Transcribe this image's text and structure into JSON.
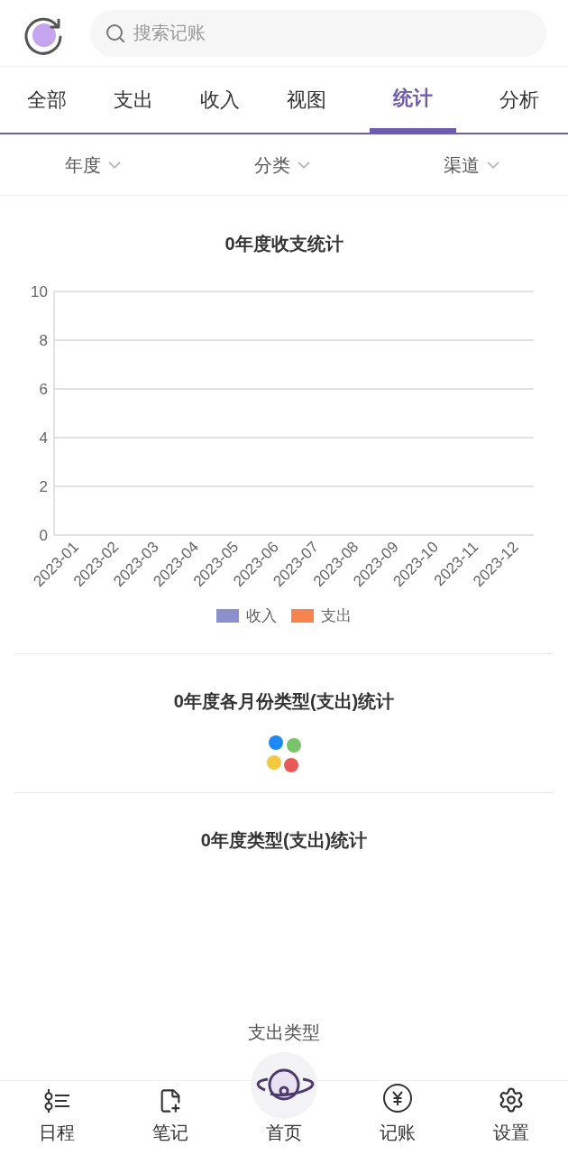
{
  "search": {
    "placeholder": "搜索记账"
  },
  "tabs": [
    {
      "label": "全部",
      "selected": false
    },
    {
      "label": "支出",
      "selected": false
    },
    {
      "label": "收入",
      "selected": false
    },
    {
      "label": "视图",
      "selected": false
    },
    {
      "label": "统计",
      "selected": true
    },
    {
      "label": "分析",
      "selected": false
    }
  ],
  "filters": [
    {
      "label": "年度"
    },
    {
      "label": "分类"
    },
    {
      "label": "渠道"
    }
  ],
  "sections": [
    {
      "title": "0年度收支统计",
      "kind": "chart",
      "chart_data": {
        "type": "bar",
        "categories": [
          "2023-01",
          "2023-02",
          "2023-03",
          "2023-04",
          "2023-05",
          "2023-06",
          "2023-07",
          "2023-08",
          "2023-09",
          "2023-10",
          "2023-11",
          "2023-12"
        ],
        "series": [
          {
            "name": "收入",
            "color": "#8c90cc",
            "values": [
              null,
              null,
              null,
              null,
              null,
              null,
              null,
              null,
              null,
              null,
              null,
              null
            ]
          },
          {
            "name": "支出",
            "color": "#f7844e",
            "values": [
              null,
              null,
              null,
              null,
              null,
              null,
              null,
              null,
              null,
              null,
              null,
              null
            ]
          }
        ],
        "grid": true,
        "ylim": [
          0,
          10
        ],
        "yticks": [
          0,
          2,
          4,
          6,
          8,
          10
        ]
      }
    },
    {
      "title": "0年度各月份类型(支出)统计",
      "kind": "loading"
    },
    {
      "title": "0年度类型(支出)统计",
      "kind": "pie",
      "caption": "支出类型"
    }
  ],
  "nav": [
    {
      "label": "日程",
      "kind": "schedule"
    },
    {
      "label": "笔记",
      "kind": "note"
    },
    {
      "label": "首页",
      "kind": "home"
    },
    {
      "label": "记账",
      "kind": "ledger"
    },
    {
      "label": "设置",
      "kind": "settings"
    }
  ]
}
